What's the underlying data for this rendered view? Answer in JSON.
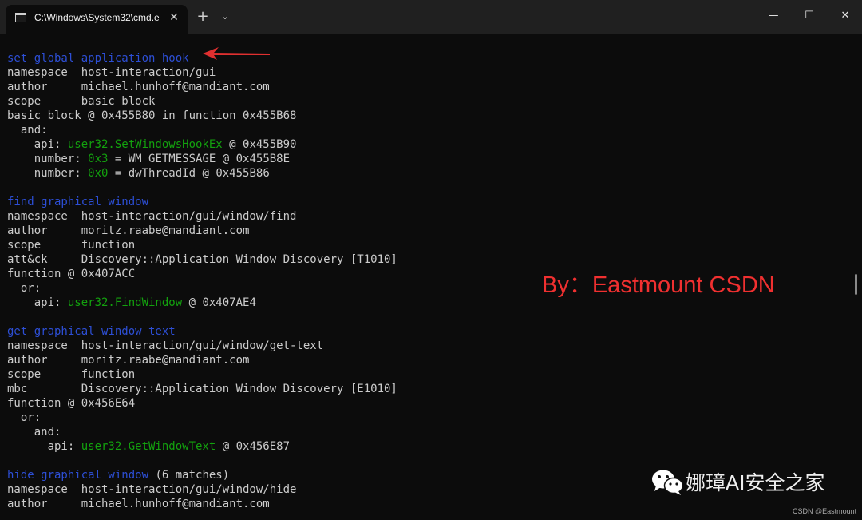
{
  "window": {
    "tab_title": "C:\\Windows\\System32\\cmd.e",
    "tab_close": "✕",
    "new_tab": "+",
    "dropdown": "⌄",
    "minimize": "—",
    "maximize": "☐",
    "close": "✕",
    "icon": "terminal-icon"
  },
  "colors": {
    "background": "#0c0c0c",
    "titlebar": "#202020",
    "rule_name": "#2d4fd6",
    "api": "#13a10e",
    "text": "#cccccc",
    "watermark": "#f03030",
    "arrow": "#e03030"
  },
  "terminal": {
    "l1_rule": "set global application hook",
    "l2": "namespace  host-interaction/gui",
    "l3": "author     michael.hunhoff@mandiant.com",
    "l4": "scope      basic block",
    "l5": "basic block @ 0x455B80 in function 0x455B68",
    "l6": "  and:",
    "l7_pre": "    api: ",
    "l7_api": "user32.SetWindowsHookEx",
    "l7_post": " @ 0x455B90",
    "l8_pre": "    number: ",
    "l8_num": "0x3",
    "l8_post": " = WM_GETMESSAGE @ 0x455B8E",
    "l9_pre": "    number: ",
    "l9_num": "0x0",
    "l9_post": " = dwThreadId @ 0x455B86",
    "l11_rule": "find graphical window",
    "l12": "namespace  host-interaction/gui/window/find",
    "l13": "author     moritz.raabe@mandiant.com",
    "l14": "scope      function",
    "l15": "att&ck     Discovery::Application Window Discovery [T1010]",
    "l16": "function @ 0x407ACC",
    "l17": "  or:",
    "l18_pre": "    api: ",
    "l18_api": "user32.FindWindow",
    "l18_post": " @ 0x407AE4",
    "l20_rule": "get graphical window text",
    "l21": "namespace  host-interaction/gui/window/get-text",
    "l22": "author     moritz.raabe@mandiant.com",
    "l23": "scope      function",
    "l24": "mbc        Discovery::Application Window Discovery [E1010]",
    "l25": "function @ 0x456E64",
    "l26": "  or:",
    "l27": "    and:",
    "l28_pre": "      api: ",
    "l28_api": "user32.GetWindowText",
    "l28_post": " @ 0x456E87",
    "l30_rule": "hide graphical window",
    "l30_post": " (6 matches)",
    "l31": "namespace  host-interaction/gui/window/hide",
    "l32": "author     michael.hunhoff@mandiant.com"
  },
  "overlay": {
    "watermark": "By：Eastmount CSDN",
    "brand_name": "娜璋AI安全之家",
    "brand_icon": "wechat-icon",
    "credit": "CSDN @Eastmount",
    "arrow_icon": "red-arrow-icon"
  }
}
